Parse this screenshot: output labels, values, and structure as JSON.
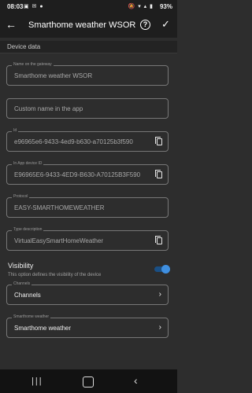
{
  "status_bar": {
    "time": "08:03",
    "left_icons": "▣ ✉ ●",
    "right_icons": "🔕 ▾ ▴ ▮",
    "battery": "93%"
  },
  "app_bar": {
    "title": "Smarthome weather WSOR",
    "help_icon_glyph": "?"
  },
  "section": {
    "title": "Device data"
  },
  "fields": {
    "name_on_gateway": {
      "label": "Name on the gateway",
      "value": "Smarthome weather WSOR"
    },
    "custom_name": {
      "placeholder": "Custom name in the app"
    },
    "id": {
      "label": "Id",
      "value": "e96965e6-9433-4ed9-b630-a70125b3f590"
    },
    "in_app_device_id": {
      "label": "In App device ID",
      "value": "E96965E6-9433-4ED9-B630-A70125B3F590"
    },
    "protocol": {
      "label": "Protocol",
      "value": "EASY-SMARTHOMEWEATHER"
    },
    "type_description": {
      "label": "Type description",
      "value": "VirtualEasySmartHomeWeather"
    },
    "channels": {
      "label": "Channels",
      "value": "Channels"
    },
    "smarthome_weather": {
      "label": "Smarthome weather",
      "value": "Smarthome weather"
    }
  },
  "visibility": {
    "title": "Visibility",
    "description": "This option defines the visibility of the device",
    "enabled": true
  },
  "colors": {
    "background": "#2d2d2d",
    "toggle_accent": "#3f8fe0"
  }
}
